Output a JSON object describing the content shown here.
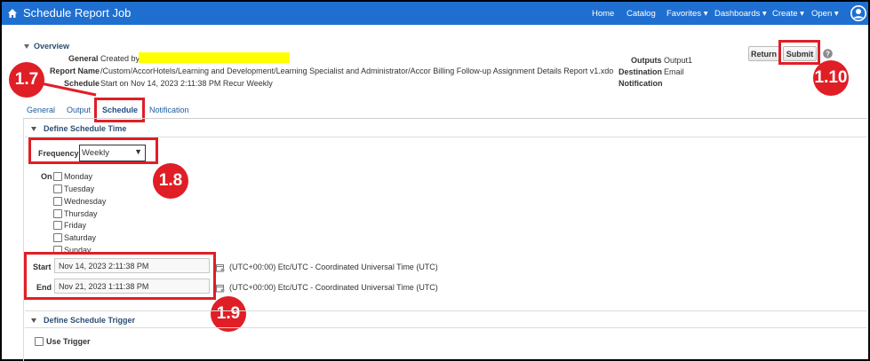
{
  "header": {
    "title": "Schedule Report Job",
    "nav": {
      "home": "Home",
      "catalog": "Catalog",
      "favorites": "Favorites",
      "dashboards": "Dashboards",
      "create": "Create",
      "open": "Open"
    }
  },
  "overview": {
    "title": "Overview",
    "general_label": "General",
    "general_value": "Created by",
    "report_name_label": "Report Name",
    "report_name_value": "/Custom/AccorHotels/Learning and Development/Learning Specialist and Administrator/Accor Billing Follow-up Assignment Details Report v1.xdo",
    "schedule_label": "Schedule",
    "schedule_value": "Start on Nov 14, 2023 2:11:38 PM Recur Weekly",
    "outputs_label": "Outputs",
    "outputs_value": "Output1",
    "destination_label": "Destination",
    "destination_value": "Email",
    "notification_label": "Notification"
  },
  "buttons": {
    "return": "Return",
    "submit": "Submit"
  },
  "tabs": [
    "General",
    "Output",
    "Schedule",
    "Notification"
  ],
  "schedule_time": {
    "title": "Define Schedule Time",
    "frequency_label": "Frequency",
    "frequency_value": "Weekly",
    "on_label": "On",
    "days": [
      "Monday",
      "Tuesday",
      "Wednesday",
      "Thursday",
      "Friday",
      "Saturday",
      "Sunday"
    ],
    "start_label": "Start",
    "start_value": "Nov 14, 2023 2:11:38 PM",
    "end_label": "End",
    "end_value": "Nov 21, 2023 1:11:38 PM",
    "timezone": "(UTC+00:00) Etc/UTC - Coordinated Universal Time (UTC)"
  },
  "schedule_trigger": {
    "title": "Define Schedule Trigger",
    "use_trigger_label": "Use Trigger"
  },
  "callouts": {
    "step_tab": "1.7",
    "step_frequency": "1.8",
    "step_dates": "1.9",
    "step_submit": "1.10"
  },
  "colors": {
    "header_bg": "#1f6fd1",
    "callout_red": "#e01e26",
    "highlight_yellow": "#ffff00"
  }
}
